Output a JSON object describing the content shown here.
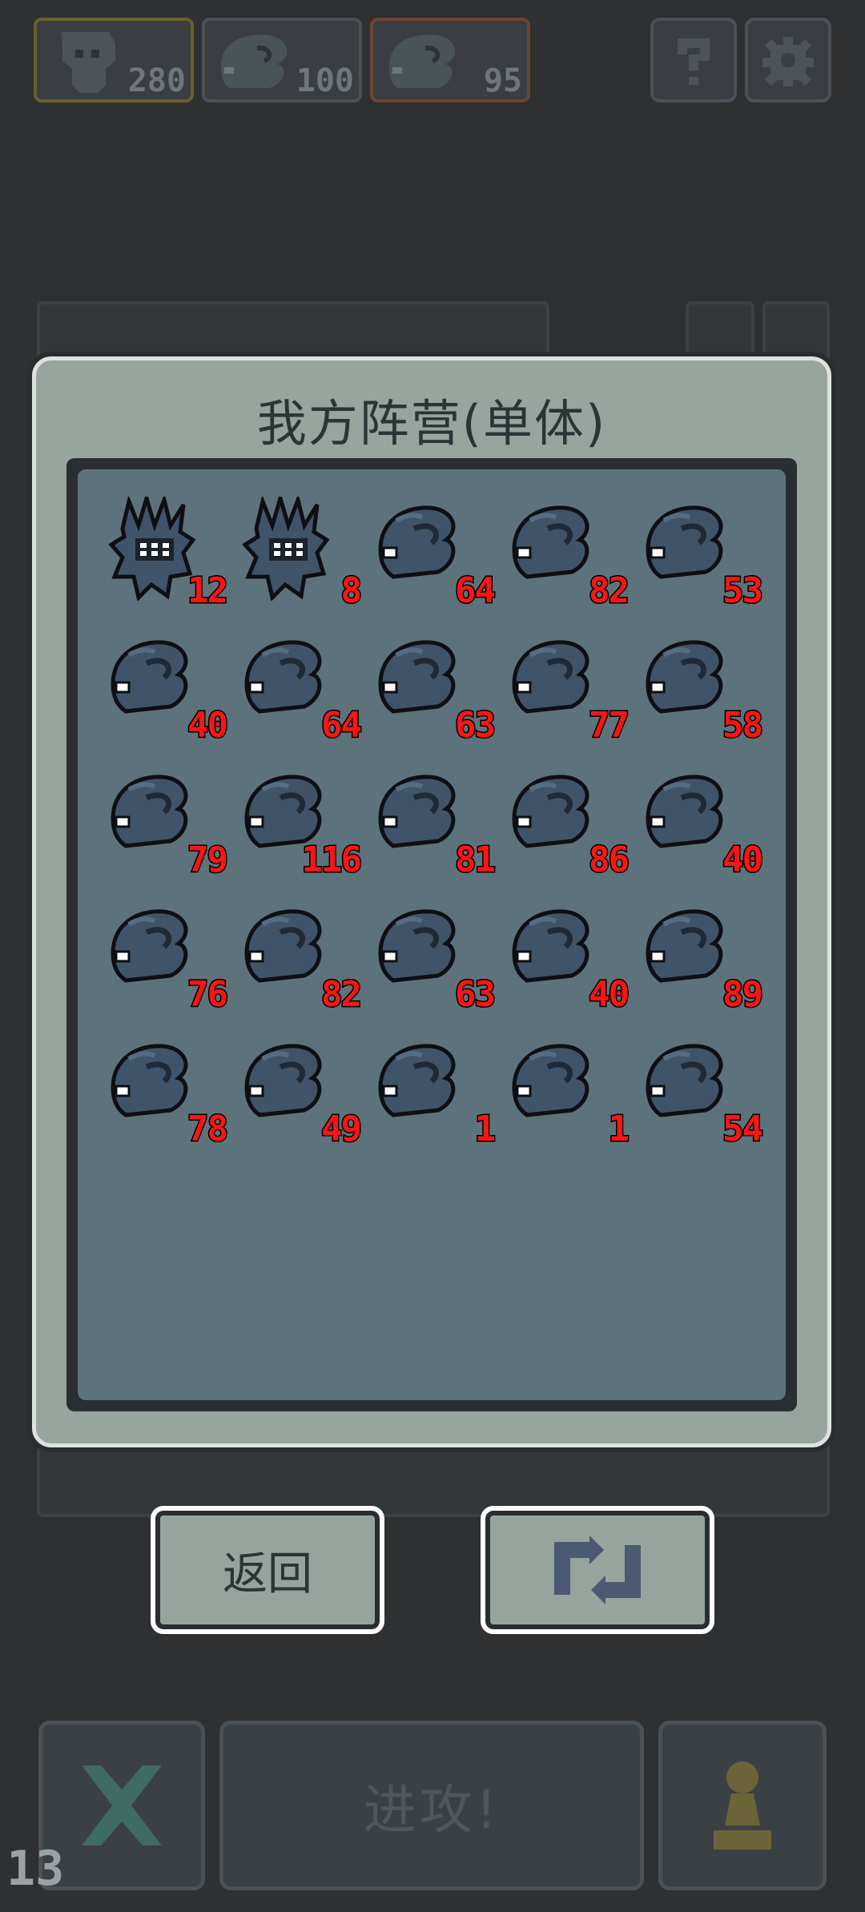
{
  "resources": [
    {
      "icon": "skull-shield-icon",
      "count": "280"
    },
    {
      "icon": "fish-unit-icon",
      "count": "100"
    },
    {
      "icon": "fish-unit-icon",
      "count": "95"
    }
  ],
  "dialog": {
    "title": "我方阵营(单体)",
    "units": [
      {
        "type": "spiky-creature",
        "count": "12"
      },
      {
        "type": "spiky-creature",
        "count": "8"
      },
      {
        "type": "fish",
        "count": "64"
      },
      {
        "type": "fish",
        "count": "82"
      },
      {
        "type": "fish",
        "count": "53"
      },
      {
        "type": "fish",
        "count": "40"
      },
      {
        "type": "fish",
        "count": "64"
      },
      {
        "type": "fish",
        "count": "63"
      },
      {
        "type": "fish",
        "count": "77"
      },
      {
        "type": "fish",
        "count": "58"
      },
      {
        "type": "fish",
        "count": "79"
      },
      {
        "type": "fish",
        "count": "116"
      },
      {
        "type": "fish",
        "count": "81"
      },
      {
        "type": "fish",
        "count": "86"
      },
      {
        "type": "fish",
        "count": "40"
      },
      {
        "type": "fish",
        "count": "76"
      },
      {
        "type": "fish",
        "count": "82"
      },
      {
        "type": "fish",
        "count": "63"
      },
      {
        "type": "fish",
        "count": "40"
      },
      {
        "type": "fish",
        "count": "89"
      },
      {
        "type": "fish",
        "count": "78"
      },
      {
        "type": "fish",
        "count": "49"
      },
      {
        "type": "fish",
        "count": "1"
      },
      {
        "type": "fish",
        "count": "1"
      },
      {
        "type": "fish",
        "count": "54"
      }
    ]
  },
  "buttons": {
    "back_label": "返回",
    "swap_icon": "swap-arrows-icon"
  },
  "bottom_bar": {
    "attack_label": "进攻!",
    "turn_number": "13"
  },
  "colors": {
    "count_red": "#ff1414",
    "dialog_bg": "#97a59e",
    "grid_bg": "#5d737b",
    "page_bg": "#2f3031"
  }
}
